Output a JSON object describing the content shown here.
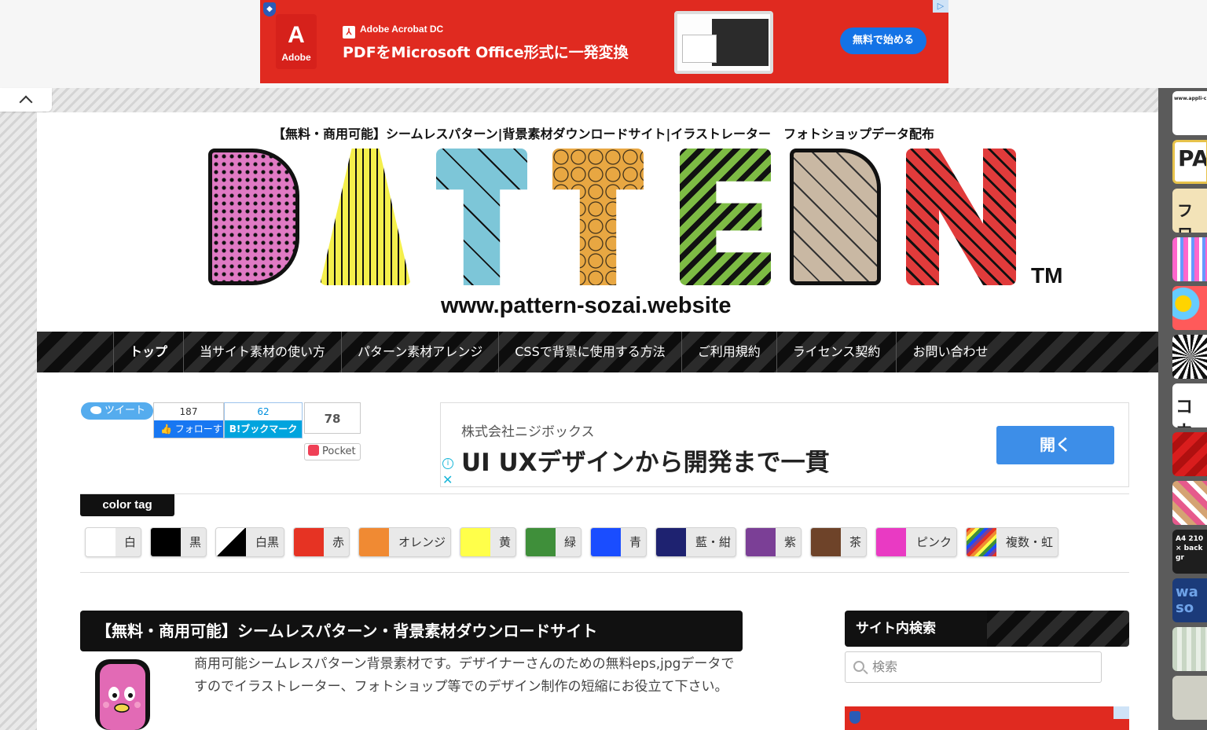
{
  "top_ad": {
    "brand": "Adobe",
    "product": "Adobe Acrobat DC",
    "headline": "PDFをMicrosoft Office形式に一発変換",
    "cta": "無料で始める"
  },
  "header": {
    "tagline": "【無料・商用可能】シームレスパターン|背景素材ダウンロードサイト|イラストレーター　フォトショップデータ配布",
    "logo_letters": [
      "P",
      "A",
      "T",
      "T",
      "E",
      "R",
      "N"
    ],
    "logo_tm": "TM",
    "logo_url": "www.pattern-sozai.website"
  },
  "nav": {
    "items": [
      {
        "label": "トップ"
      },
      {
        "label": "当サイト素材の使い方"
      },
      {
        "label": "パターン素材アレンジ"
      },
      {
        "label": "CSSで背景に使用する方法"
      },
      {
        "label": "ご利用規約"
      },
      {
        "label": "ライセンス契約"
      },
      {
        "label": "お問い合わせ"
      }
    ]
  },
  "social": {
    "tweet": "ツイート",
    "fb_count": "187",
    "fb_label": "フォローする",
    "hatena_count": "62",
    "hatena_label": "B!ブックマーク",
    "pocket_count": "78",
    "pocket_label": "Pocket"
  },
  "mid_ad": {
    "company": "株式会社ニジボックス",
    "headline": "UI UXデザインから開発まで一貫",
    "button": "開く"
  },
  "color_tag": {
    "heading": "color tag",
    "tags": [
      {
        "label": "白",
        "color": "#ffffff"
      },
      {
        "label": "黒",
        "color": "#000000"
      },
      {
        "label": "白黒",
        "color": "split-bw"
      },
      {
        "label": "赤",
        "color": "#e63323"
      },
      {
        "label": "オレンジ",
        "color": "#f08a33"
      },
      {
        "label": "黄",
        "color": "#ffff4a"
      },
      {
        "label": "緑",
        "color": "#3f8f3a"
      },
      {
        "label": "青",
        "color": "#1a4dff"
      },
      {
        "label": "藍・紺",
        "color": "#1e2270"
      },
      {
        "label": "紫",
        "color": "#7b3f96"
      },
      {
        "label": "茶",
        "color": "#6e4329"
      },
      {
        "label": "ピンク",
        "color": "#e93ac3"
      },
      {
        "label": "複数・虹",
        "color": "rainbow"
      }
    ]
  },
  "article": {
    "title": "【無料・商用可能】シームレスパターン・背景素材ダウンロードサイト",
    "intro": "商用可能シームレスパターン背景素材です。デザイナーさんのための無料eps,jpgデータですのでイラストレーター、フォトショップ等でのデザイン制作の短縮にお役立て下さい。"
  },
  "sidebar": {
    "search_heading": "サイト内検索",
    "search_placeholder": "検索"
  },
  "side_thumbs": [
    "www.appli-c",
    "PA",
    "フロ",
    "",
    "",
    "",
    "コウ",
    "",
    "",
    "A4 210 × back gr",
    "wa so",
    "",
    ""
  ]
}
